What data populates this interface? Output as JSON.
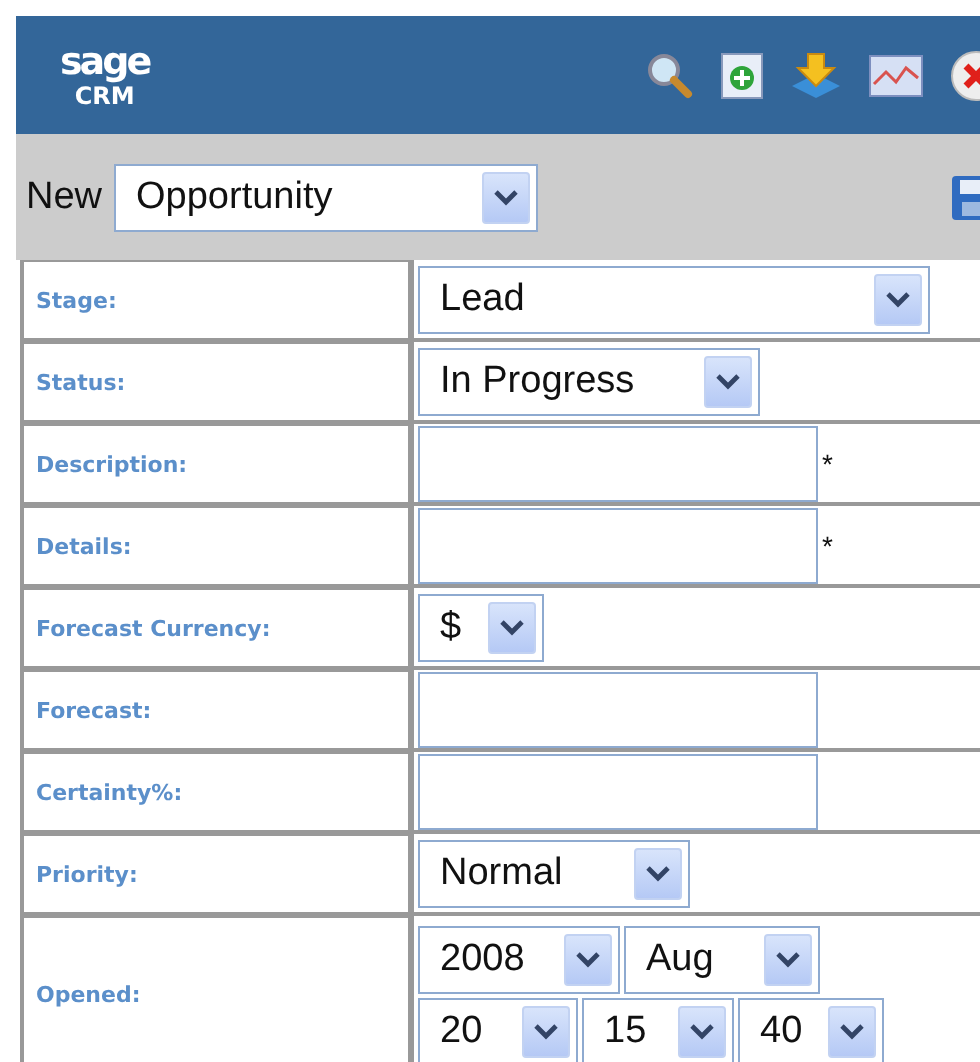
{
  "header": {
    "logo_top": "sage",
    "logo_bottom": "CRM"
  },
  "toolbar": {
    "label": "New",
    "select_value": "Opportunity"
  },
  "fields": [
    {
      "label": "Stage:",
      "kind": "select",
      "value": "Lead"
    },
    {
      "label": "Status:",
      "kind": "select",
      "value": "In Progress"
    },
    {
      "label": "Description:",
      "kind": "text",
      "required_mark": "*"
    },
    {
      "label": "Details:",
      "kind": "text",
      "required_mark": "*"
    },
    {
      "label": "Forecast Currency:",
      "kind": "select",
      "value": "$"
    },
    {
      "label": "Forecast:",
      "kind": "text"
    },
    {
      "label": "Certainty%:",
      "kind": "text"
    },
    {
      "label": "Priority:",
      "kind": "select",
      "value": "Normal"
    },
    {
      "label": "Opened:",
      "kind": "datetime",
      "parts": [
        "2008",
        "Aug",
        "20",
        "15",
        "40"
      ]
    }
  ]
}
